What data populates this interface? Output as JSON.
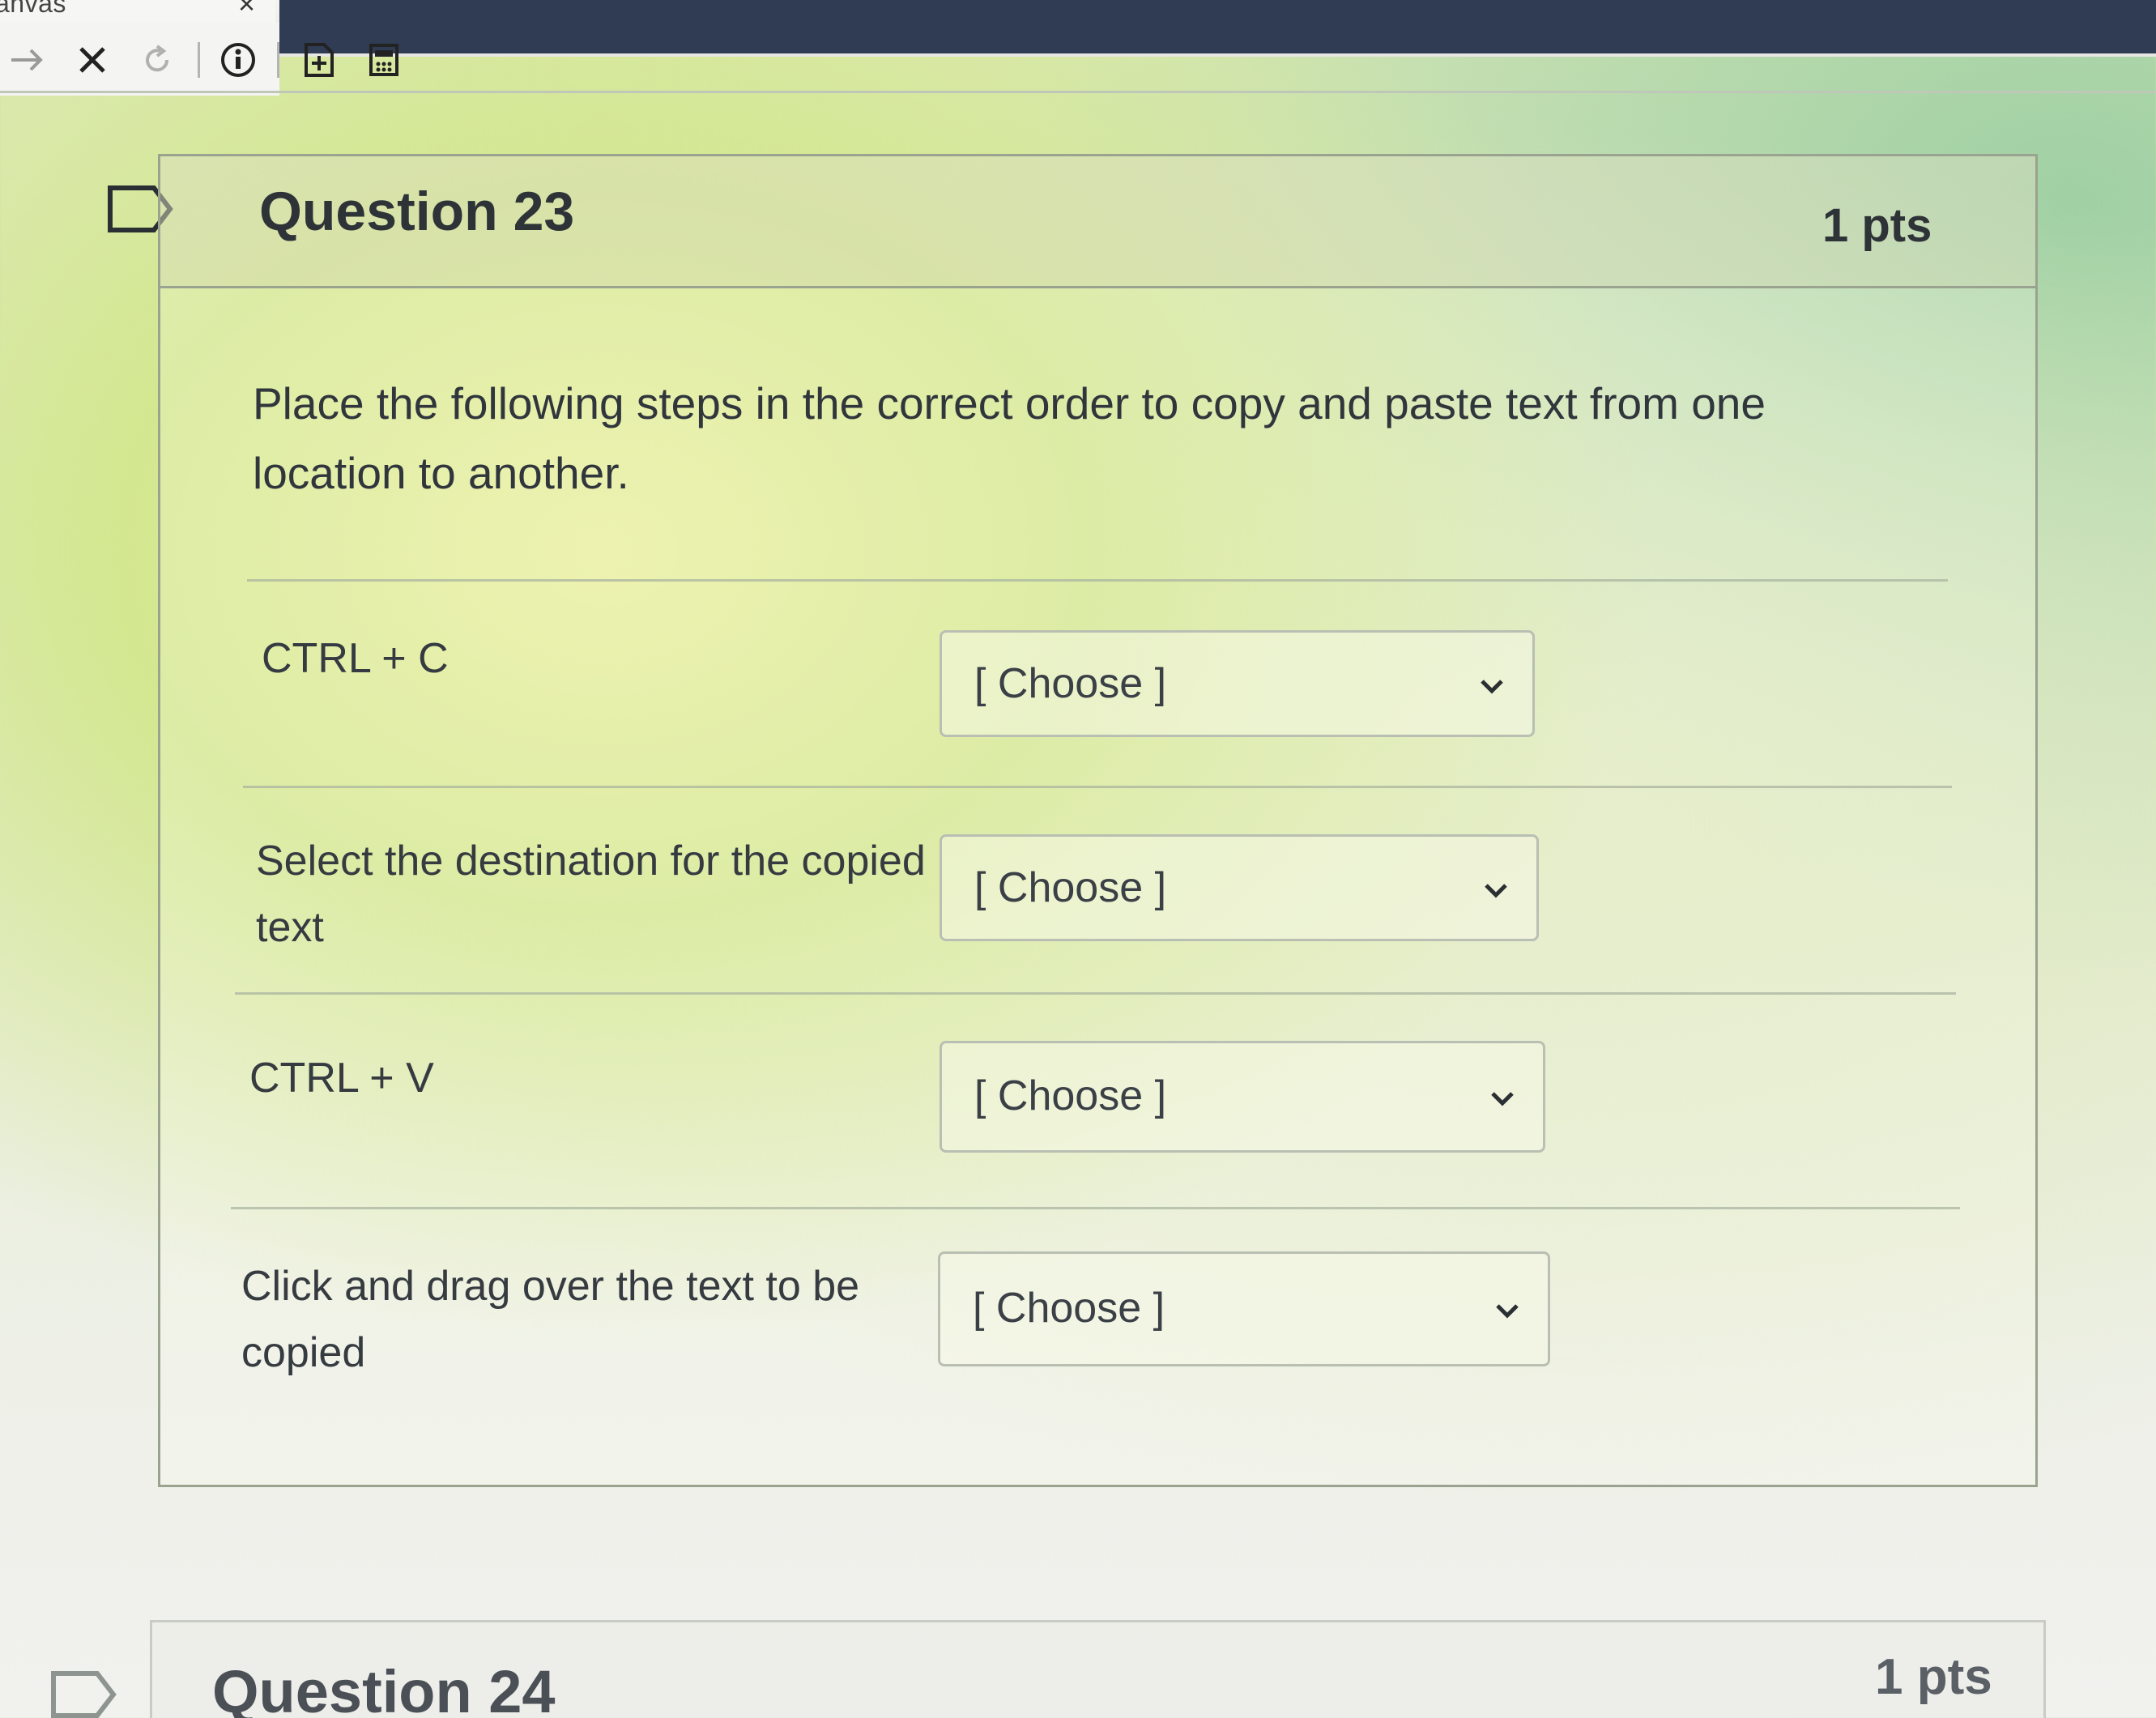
{
  "browser": {
    "tab_title": "anvas",
    "toolbar": {
      "icons": [
        "forward-arrow-icon",
        "close-icon",
        "reload-icon",
        "info-icon",
        "add-page-icon",
        "calculator-icon"
      ]
    }
  },
  "question_23": {
    "title": "Question 23",
    "points": "1 pts",
    "prompt": "Place the following steps in the correct order to copy and paste text from one location to another.",
    "rows": [
      {
        "label": "CTRL + C",
        "select_value": "[ Choose ]"
      },
      {
        "label": "Select the destination for the copied text",
        "select_value": "[ Choose ]"
      },
      {
        "label": "CTRL + V",
        "select_value": "[ Choose ]"
      },
      {
        "label": "Click and drag over the text to be copied",
        "select_value": "[ Choose ]"
      }
    ]
  },
  "question_24": {
    "title": "Question 24",
    "points": "1 pts"
  },
  "colors": {
    "chrome_dark": "#2f3c54",
    "text": "#2e3338",
    "border": "#9aa38f"
  }
}
